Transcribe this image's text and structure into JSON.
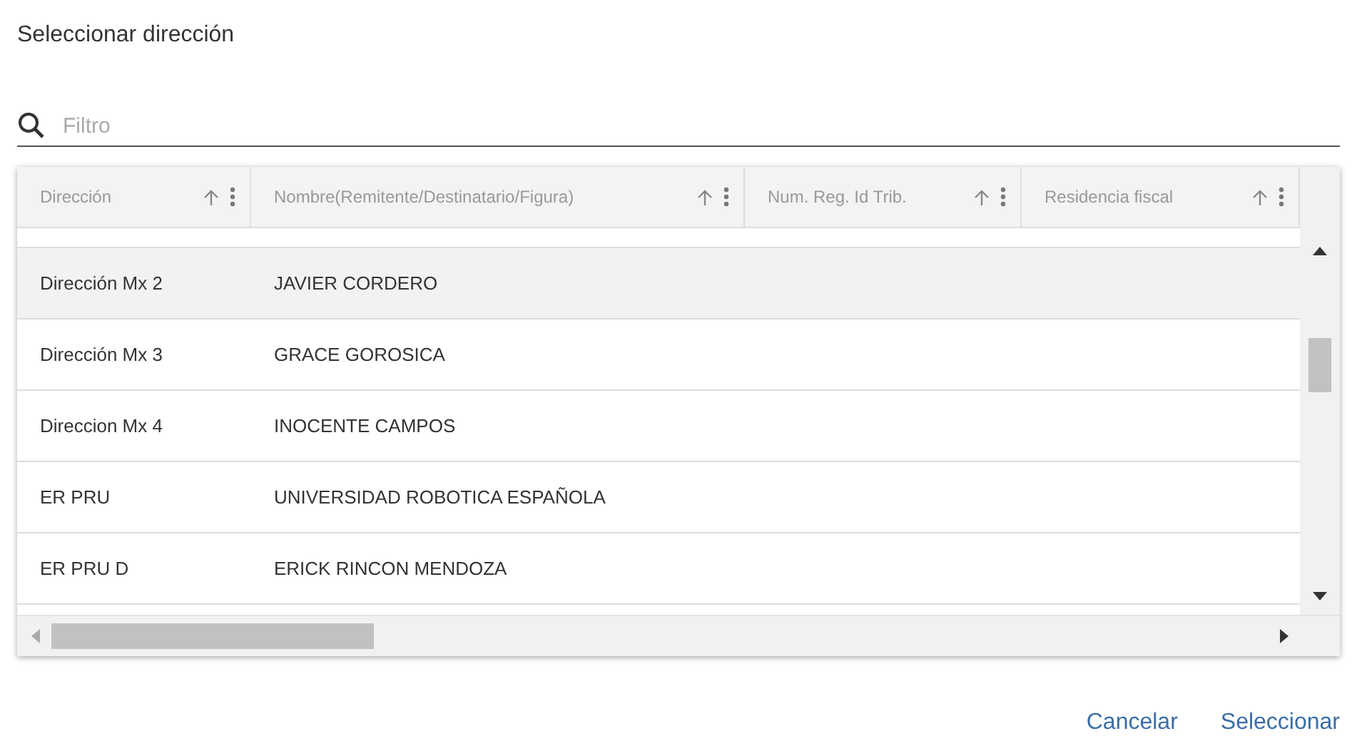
{
  "dialog": {
    "title": "Seleccionar dirección"
  },
  "filter": {
    "placeholder": "Filtro"
  },
  "table": {
    "columns": [
      "Dirección",
      "Nombre(Remitente/Destinatario/Figura)",
      "Num. Reg. Id Trib.",
      "Residencia fiscal"
    ],
    "rows": [
      {
        "cells": [
          "Dirección Mx 2",
          "JAVIER CORDERO"
        ],
        "selected": true
      },
      {
        "cells": [
          "Dirección Mx 3",
          "GRACE GOROSICA"
        ],
        "selected": false
      },
      {
        "cells": [
          "Direccion Mx 4",
          "INOCENTE CAMPOS"
        ],
        "selected": false
      },
      {
        "cells": [
          "ER PRU",
          "UNIVERSIDAD ROBOTICA ESPAÑOLA"
        ],
        "selected": false
      },
      {
        "cells": [
          "ER PRU D",
          "ERICK RINCON MENDOZA"
        ],
        "selected": false
      }
    ]
  },
  "buttons": [
    "Cancelar",
    "Seleccionar"
  ]
}
